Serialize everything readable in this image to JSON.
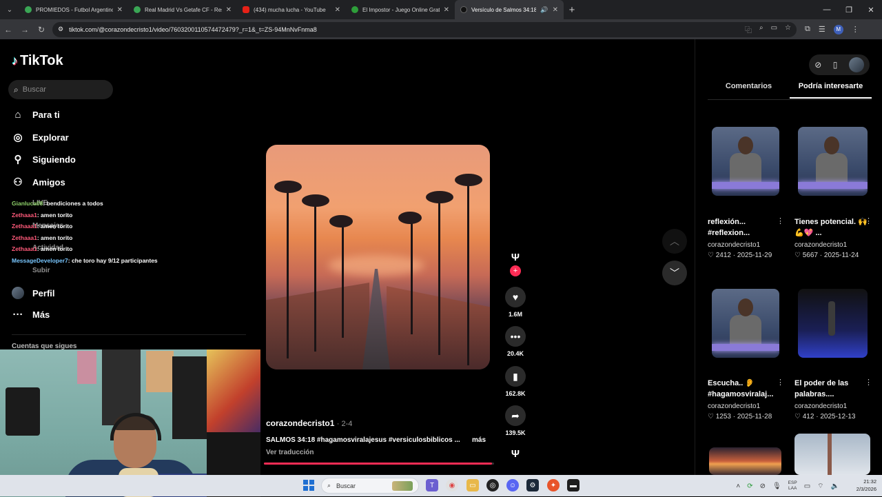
{
  "browser": {
    "tabs": [
      {
        "label": "PROMIEDOS - Futbol Argentino",
        "color": "#3aa655",
        "active": false
      },
      {
        "label": "Real Madrid Vs Getafe CF - Res",
        "color": "#3aa655",
        "active": false
      },
      {
        "label": "(434) mucha lucha - YouTube",
        "color": "#e62117",
        "active": false
      },
      {
        "label": "El Impostor - Juego Online Grat",
        "color": "#2e9e3a",
        "active": false
      },
      {
        "label": "Versículo de Salmos 34:18",
        "color": "#111111",
        "active": true
      }
    ],
    "url": "tiktok.com/@corazondecristo1/video/7603200110574472479?_r=1&_t=ZS-94MnNvFnma8",
    "profile_letter": "M"
  },
  "tiktok": {
    "brand": "TikTok",
    "search_placeholder": "Buscar",
    "nav": [
      {
        "label": "Para ti",
        "icon": "home-icon"
      },
      {
        "label": "Explorar",
        "icon": "compass-icon"
      },
      {
        "label": "Siguiendo",
        "icon": "following-icon"
      },
      {
        "label": "Amigos",
        "icon": "friends-icon"
      },
      {
        "label": "Perfil",
        "icon": "avatar-icon"
      },
      {
        "label": "Más",
        "icon": "more-icon"
      }
    ],
    "hidden_nav_partial": [
      "LIVE",
      "Mensajes",
      "Actividad",
      "Subir"
    ],
    "chat_overlay": [
      {
        "user": "Gianluca08",
        "message": ": bendiciones a todos"
      },
      {
        "user": "Zethaaa1",
        "message": ": amen torito"
      },
      {
        "user": "Zethaaa1",
        "message": ": amen torito"
      },
      {
        "user": "Zethaaa1",
        "message": ": amen torito"
      },
      {
        "user": "Zethaaa1",
        "message": ": amen torito"
      },
      {
        "user": "MessageDeveloper7",
        "message": ": che toro hay 9/12 participantes"
      }
    ],
    "following_heading": "Cuentas que sigues",
    "video": {
      "author": "corazondecristo1",
      "date": "· 2-4",
      "caption": "SALMOS 34:18 #hagamosviralajesus #versiculosbiblicos ...",
      "more": "más",
      "translate": "Ver traducción",
      "progress_fraction": 0.99
    },
    "actions": [
      {
        "name": "like",
        "count": "1.6M"
      },
      {
        "name": "comment",
        "count": "20.4K"
      },
      {
        "name": "save",
        "count": "162.8K"
      },
      {
        "name": "share",
        "count": "139.5K"
      }
    ],
    "right_panel": {
      "tabs": [
        "Comentarios",
        "Podría interesarte"
      ],
      "active_tab": 1,
      "cards": [
        {
          "title": "reflexión... #reflexion...",
          "user": "corazondecristo1",
          "likes": "2412",
          "date": "2025-11-29"
        },
        {
          "title": "Tienes potencial. 🙌💪💖 ...",
          "user": "corazondecristo1",
          "likes": "5667",
          "date": "2025-11-24"
        },
        {
          "title": "Escucha.. 👂 #hagamosviralaj...",
          "user": "corazondecristo1",
          "likes": "1253",
          "date": "2025-11-28"
        },
        {
          "title": "El poder de las palabras....",
          "user": "corazondecristo1",
          "likes": "412",
          "date": "2025-12-13"
        }
      ]
    }
  },
  "taskbar": {
    "search_placeholder": "Buscar",
    "lang": "ESP\nLAA",
    "time": "21:32",
    "date": "2/3/2026"
  }
}
